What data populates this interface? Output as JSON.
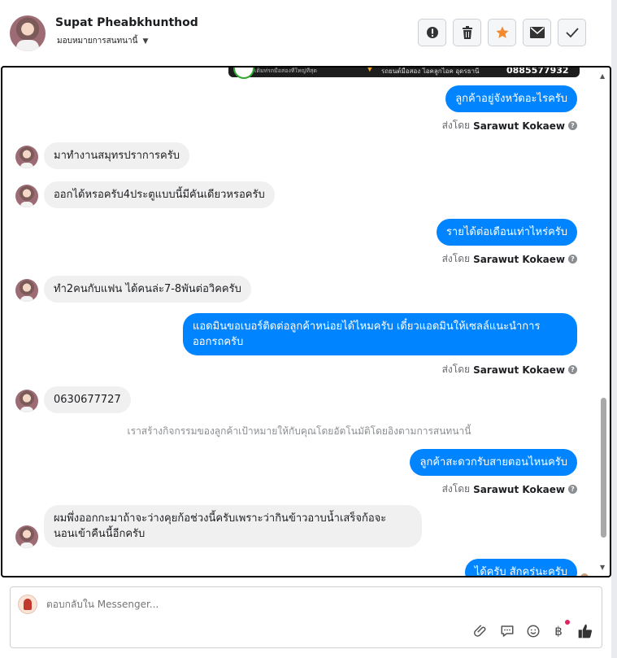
{
  "header": {
    "contact_name": "Supat Pheabkhunthod",
    "assign_label": "มอบหมายการสนทนานี้",
    "toolbar": [
      {
        "name": "report-button",
        "icon": "alert-icon"
      },
      {
        "name": "delete-button",
        "icon": "trash-icon"
      },
      {
        "name": "star-button",
        "icon": "star-icon"
      },
      {
        "name": "mark-unread-button",
        "icon": "envelope-icon"
      },
      {
        "name": "mark-done-button",
        "icon": "check-icon"
      }
    ]
  },
  "banner": {
    "text": "รถยนต์มือสอง ไอคลูกไอค อุดรธานี",
    "phone": "0885577932",
    "tagline": "เติมท่รถมือสองที่ใหญ่ที่สุด"
  },
  "messages": {
    "m1": "ลูกค้าอยู่จังหวัดอะไรครับ",
    "m2": "มาทำงานสมุทรปราการครับ",
    "m3": "ออกได้หรอครับ4ประตูแบบนี้มีคันเดียวหรอครับ",
    "m4": "รายได้ต่อเดือนเท่าไหร่ครับ",
    "m5": "ทำ2คนกับแฟน ได้คนล่ะ7-8พันต่อวิคครับ",
    "m6_line1": "แอดมินขอเบอร์ติดต่อลูกค้าหน่อยได้ไหมครับ เดี๋ยวแอดมินให้เซลล์แนะนำการ",
    "m6_line2": "ออกรถครับ",
    "m7": "0630677727",
    "system": "เราสร้างกิจกรรมของลูกค้าเป้าหมายให้กับคุณโดยอัตโนมัติโดยอิงตามการสนทนานี้",
    "m8": "ลูกค้าสะดวกรับสายตอนไหนครับ",
    "m9_line1": "ผมพึ่งออกกะมาถ้าจะว่างคุยก้อช่วงนี้ครับเพราะว่ากินข้าวอาบน้ำเสร็จก้อจะ",
    "m9_line2": "นอนเข้าคืนนี้อีกครับ",
    "m10": "ได้ครับ สักครู่นะครับ"
  },
  "sent_by": {
    "prefix": "ส่งโดย",
    "agent": "Sarawut Kokaew",
    "info_glyph": "?"
  },
  "composer": {
    "placeholder": "ตอบกลับใน Messenger...",
    "tools": [
      "attach-icon",
      "saved-reply-icon",
      "emoji-icon",
      "baht-payment-icon",
      "thumbs-up-icon"
    ],
    "baht_glyph": "฿"
  }
}
